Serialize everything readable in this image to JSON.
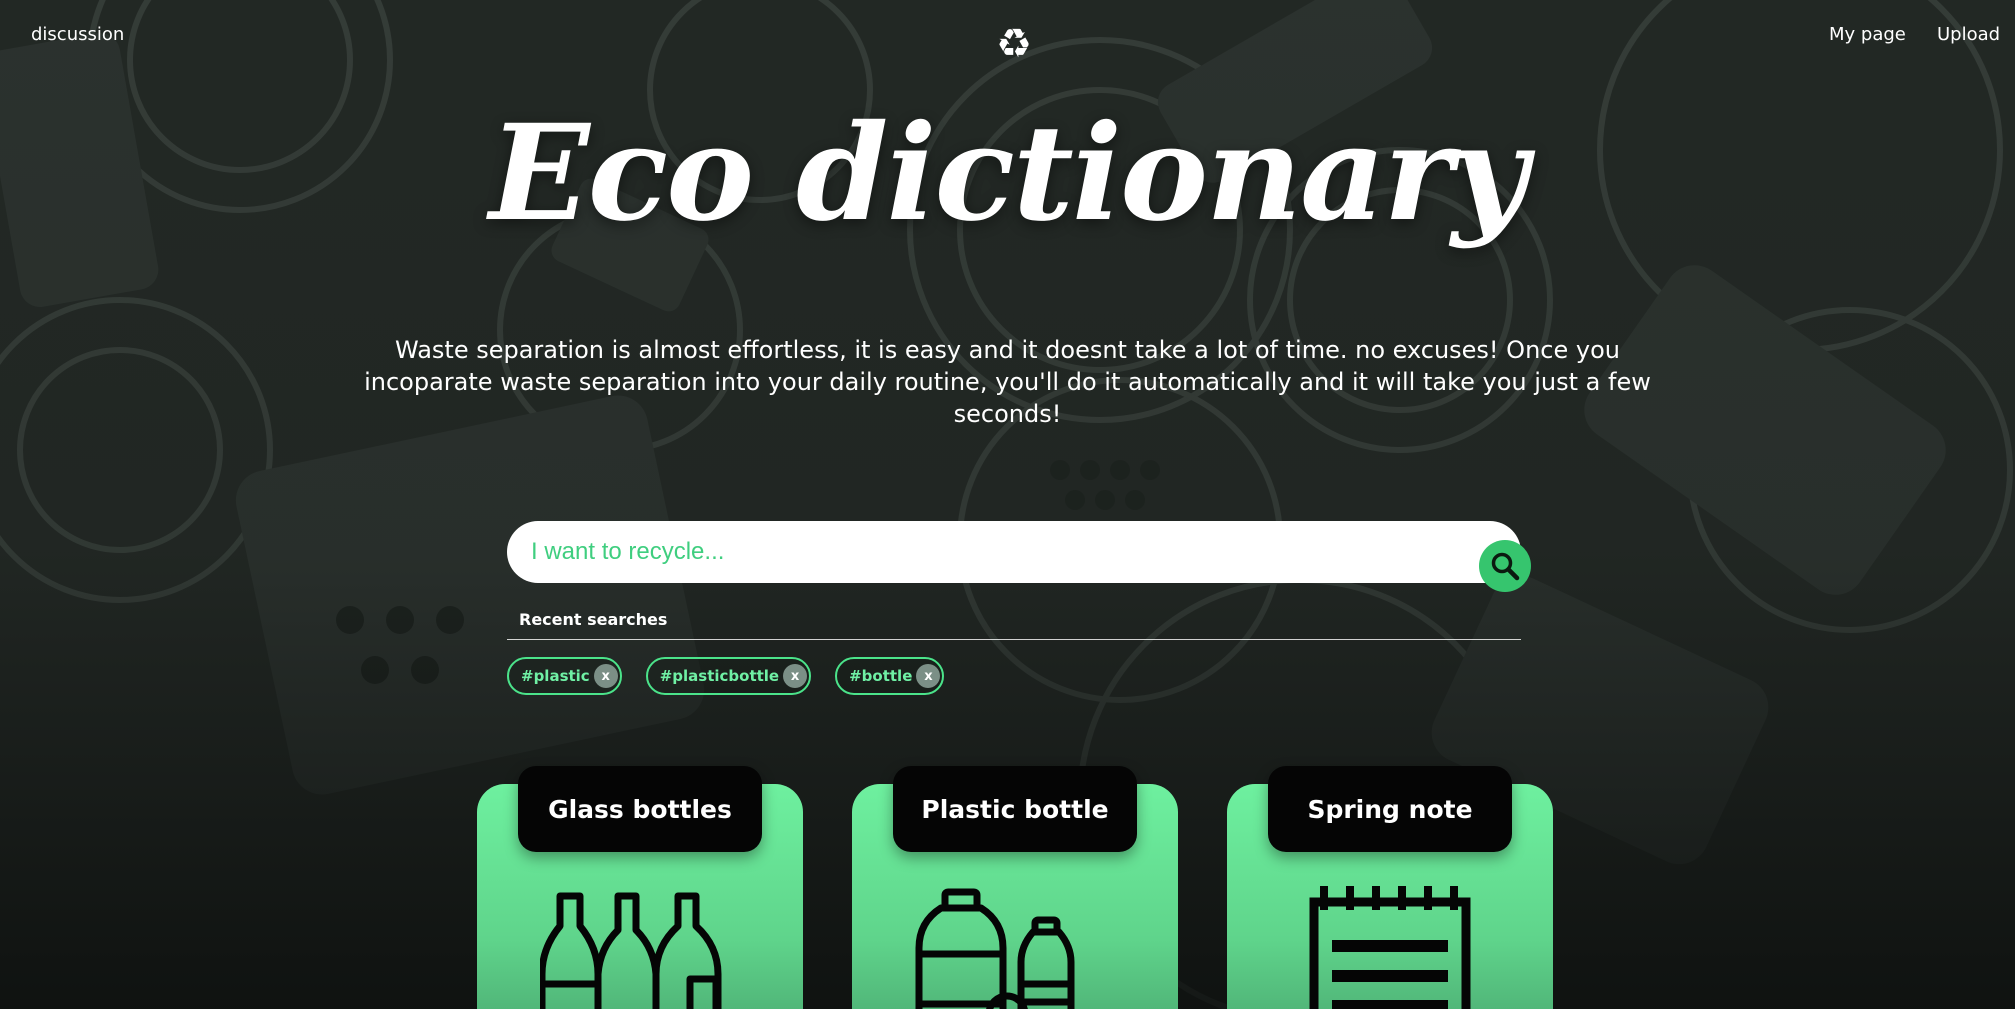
{
  "nav": {
    "discussion_label": "discussion",
    "mypage_label": "My page",
    "upload_label": "Upload",
    "logo_icon": "recycle-icon",
    "logo_glyph": "♻"
  },
  "hero": {
    "title": "Eco dictionary",
    "tagline": "Waste separation is almost effortless, it is easy and it doesnt take a lot of time. no excuses! Once you incoparate waste separation into your daily routine, you'll do it automatically and it will take you just a few seconds!"
  },
  "search": {
    "placeholder": "I want to recycle...",
    "value": "",
    "button_icon": "search-icon",
    "recent_label": "Recent searches",
    "recent": [
      {
        "label": "#plastic",
        "remove": "x"
      },
      {
        "label": "#plasticbottle",
        "remove": "x"
      },
      {
        "label": "#bottle",
        "remove": "x"
      }
    ]
  },
  "categories": [
    {
      "label": "Glass bottles",
      "icon": "glass-bottles-icon"
    },
    {
      "label": "Plastic bottle",
      "icon": "plastic-bottle-icon"
    },
    {
      "label": "Spring note",
      "icon": "spring-note-icon"
    }
  ],
  "colors": {
    "accent": "#36c56e",
    "card_green": "#6ef09f",
    "tag_border": "#4be38a",
    "background": "#1f2421"
  }
}
